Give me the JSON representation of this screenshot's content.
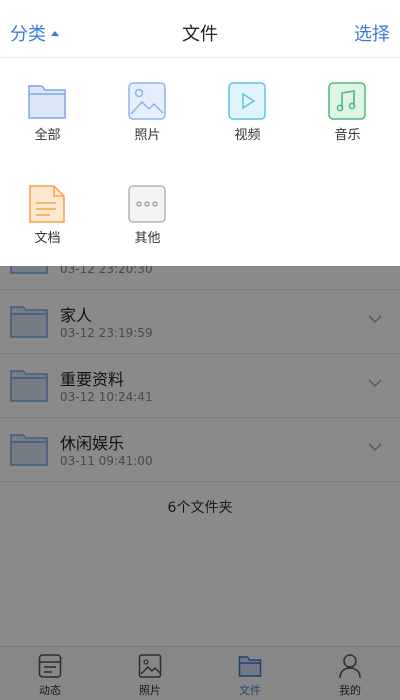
{
  "header": {
    "left_label": "分类",
    "title": "文件",
    "right_label": "选择"
  },
  "categories": [
    {
      "label": "全部",
      "icon": "folder-icon"
    },
    {
      "label": "照片",
      "icon": "photo-icon"
    },
    {
      "label": "视频",
      "icon": "video-icon"
    },
    {
      "label": "音乐",
      "icon": "music-icon"
    },
    {
      "label": "文档",
      "icon": "document-icon"
    },
    {
      "label": "其他",
      "icon": "more-icon"
    }
  ],
  "files": [
    {
      "name": "",
      "date": "03-12 23:20:30"
    },
    {
      "name": "家人",
      "date": "03-12 23:19:59"
    },
    {
      "name": "重要资料",
      "date": "03-12 10:24:41"
    },
    {
      "name": "休闲娱乐",
      "date": "03-11 09:41:00"
    }
  ],
  "folder_count": "6个文件夹",
  "tabbar": [
    {
      "label": "动态",
      "icon": "feed-icon"
    },
    {
      "label": "照片",
      "icon": "photo-icon"
    },
    {
      "label": "文件",
      "icon": "folder-icon"
    },
    {
      "label": "我的",
      "icon": "person-icon"
    }
  ],
  "colors": {
    "accent": "#3a7bd5",
    "folder_blue": "#7aa7e6",
    "photo_blue": "#8db4ef",
    "video_cyan": "#5fc1e8",
    "music_green": "#4db87c",
    "doc_orange": "#f2a34f",
    "more_grey": "#b5b5b5"
  }
}
